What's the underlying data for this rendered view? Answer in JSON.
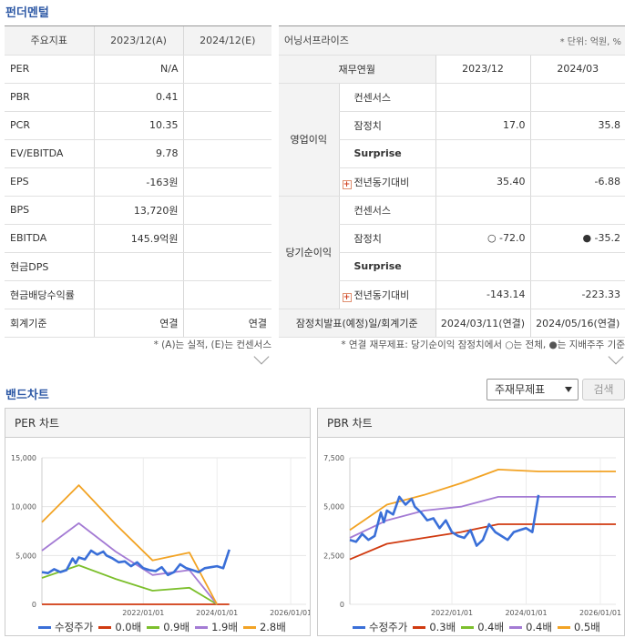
{
  "fundamental": {
    "title": "펀더멘털",
    "headers": [
      "주요지표",
      "2023/12(A)",
      "2024/12(E)"
    ],
    "rows": [
      {
        "label": "PER",
        "a": "N/A",
        "e": ""
      },
      {
        "label": "PBR",
        "a": "0.41",
        "e": ""
      },
      {
        "label": "PCR",
        "a": "10.35",
        "e": ""
      },
      {
        "label": "EV/EBITDA",
        "a": "9.78",
        "e": ""
      },
      {
        "label": "EPS",
        "a": "-163원",
        "e": ""
      },
      {
        "label": "BPS",
        "a": "13,720원",
        "e": ""
      },
      {
        "label": "EBITDA",
        "a": "145.9억원",
        "e": ""
      },
      {
        "label": "현금DPS",
        "a": "",
        "e": ""
      },
      {
        "label": "현금배당수익률",
        "a": "",
        "e": ""
      },
      {
        "label": "회계기준",
        "a": "연결",
        "e": "연결"
      }
    ],
    "note": "* (A)는 실적, (E)는 컨센서스"
  },
  "earnings": {
    "title": "어닝서프라이즈",
    "unit": "* 단위: 억원, %",
    "sub_header": "재무연월",
    "col1": "2023/12",
    "col2": "2024/03",
    "groups": [
      {
        "name": "영업이익",
        "rows": [
          {
            "label": "컨센서스",
            "v1": "",
            "v2": "",
            "plus": false,
            "bold": false
          },
          {
            "label": "잠정치",
            "v1": "17.0",
            "v2": "35.8",
            "plus": false,
            "bold": false
          },
          {
            "label": "Surprise",
            "v1": "",
            "v2": "",
            "plus": false,
            "bold": true
          },
          {
            "label": "전년동기대비",
            "v1": "35.40",
            "v2": "-6.88",
            "plus": true,
            "bold": false
          }
        ]
      },
      {
        "name": "당기순이익",
        "rows": [
          {
            "label": "컨센서스",
            "v1": "",
            "v2": "",
            "plus": false,
            "bold": false
          },
          {
            "label": "잠정치",
            "v1": "○ -72.0",
            "v2": "● -35.2",
            "plus": false,
            "bold": false
          },
          {
            "label": "Surprise",
            "v1": "",
            "v2": "",
            "plus": false,
            "bold": true
          },
          {
            "label": "전년동기대비",
            "v1": "-143.14",
            "v2": "-223.33",
            "plus": true,
            "bold": false
          }
        ]
      }
    ],
    "footer": {
      "label": "잠정치발표(예정)일/회계기준",
      "v1": "2024/03/11(연결)",
      "v2": "2024/05/16(연결)"
    },
    "note": "* 연결 재무제표: 당기순이익 잠정치에서 ○는 전체, ●는 지배주주 기준"
  },
  "band": {
    "title": "밴드차트",
    "select_value": "주재무제표",
    "search_label": "검색"
  },
  "chart_data": [
    {
      "type": "line",
      "title": "PER 차트",
      "x_ticks": [
        "2022/01/01",
        "2024/01/01",
        "2026/01/01"
      ],
      "y_ticks": [
        "15,000",
        "10,000",
        "5,000",
        "0"
      ],
      "ylim": [
        0,
        15000
      ],
      "xlim": [
        "2019/04/01",
        "2026/06/01"
      ],
      "series": [
        {
          "name": "수정주가",
          "color": "#3a6fd8",
          "dates": [
            "2019/04",
            "2019/06",
            "2019/08",
            "2019/10",
            "2019/12",
            "2020/02",
            "2020/03",
            "2020/04",
            "2020/06",
            "2020/08",
            "2020/10",
            "2020/12",
            "2021/01",
            "2021/03",
            "2021/05",
            "2021/07",
            "2021/09",
            "2021/11",
            "2022/01",
            "2022/03",
            "2022/05",
            "2022/07",
            "2022/09",
            "2022/11",
            "2023/01",
            "2023/03",
            "2023/05",
            "2023/07",
            "2023/09",
            "2023/11",
            "2024/01",
            "2024/03",
            "2024/05"
          ],
          "values": [
            3300,
            3200,
            3600,
            3300,
            3500,
            4700,
            4200,
            4800,
            4600,
            5500,
            5100,
            5400,
            5000,
            4700,
            4300,
            4400,
            3900,
            4300,
            3700,
            3500,
            3400,
            3800,
            3000,
            3300,
            4100,
            3700,
            3500,
            3300,
            3700,
            3800,
            3900,
            3700,
            5600
          ]
        },
        {
          "name": "0.0배",
          "color": "#d03a10",
          "dates": [
            "2019/04",
            "2024/05"
          ],
          "values": [
            0,
            0
          ]
        },
        {
          "name": "0.9배",
          "color": "#7cbf2c",
          "dates": [
            "2019/04",
            "2020/04",
            "2021/04",
            "2022/04",
            "2023/04",
            "2024/01"
          ],
          "values": [
            2700,
            4000,
            2600,
            1400,
            1700,
            0
          ]
        },
        {
          "name": "1.9배",
          "color": "#a47bd4",
          "dates": [
            "2019/04",
            "2020/04",
            "2021/04",
            "2022/04",
            "2023/04",
            "2024/01"
          ],
          "values": [
            5500,
            8300,
            5400,
            3000,
            3500,
            0
          ]
        },
        {
          "name": "2.8배",
          "color": "#f2a324",
          "dates": [
            "2019/04",
            "2020/04",
            "2021/04",
            "2022/04",
            "2023/04",
            "2024/01"
          ],
          "values": [
            8400,
            12200,
            8200,
            4500,
            5300,
            0
          ]
        }
      ]
    },
    {
      "type": "line",
      "title": "PBR 차트",
      "x_ticks": [
        "2022/01/01",
        "2024/01/01",
        "2026/01/01"
      ],
      "y_ticks": [
        "7,500",
        "5,000",
        "2,500",
        "0"
      ],
      "ylim": [
        0,
        7500
      ],
      "xlim": [
        "2019/04/01",
        "2026/06/01"
      ],
      "series": [
        {
          "name": "수정주가",
          "color": "#3a6fd8",
          "dates": [
            "2019/04",
            "2019/06",
            "2019/08",
            "2019/10",
            "2019/12",
            "2020/02",
            "2020/03",
            "2020/04",
            "2020/06",
            "2020/08",
            "2020/10",
            "2020/12",
            "2021/01",
            "2021/03",
            "2021/05",
            "2021/07",
            "2021/09",
            "2021/11",
            "2022/01",
            "2022/03",
            "2022/05",
            "2022/07",
            "2022/09",
            "2022/11",
            "2023/01",
            "2023/03",
            "2023/05",
            "2023/07",
            "2023/09",
            "2023/11",
            "2024/01",
            "2024/03",
            "2024/05"
          ],
          "values": [
            3300,
            3200,
            3600,
            3300,
            3500,
            4700,
            4200,
            4800,
            4600,
            5500,
            5100,
            5400,
            5000,
            4700,
            4300,
            4400,
            3900,
            4300,
            3700,
            3500,
            3400,
            3800,
            3000,
            3300,
            4100,
            3700,
            3500,
            3300,
            3700,
            3800,
            3900,
            3700,
            5600
          ]
        },
        {
          "name": "0.3배",
          "color": "#d03a10",
          "dates": [
            "2019/04",
            "2020/04",
            "2021/04",
            "2022/04",
            "2023/04",
            "2024/05",
            "2026/06"
          ],
          "values": [
            2300,
            3100,
            3400,
            3700,
            4100,
            4100,
            4100
          ]
        },
        {
          "name": "0.4배",
          "color": "#7cbf2c",
          "dates": [],
          "values": []
        },
        {
          "name": "0.4배",
          "color": "#a47bd4",
          "dates": [
            "2019/04",
            "2020/04",
            "2021/04",
            "2022/04",
            "2023/04",
            "2024/05",
            "2026/06"
          ],
          "values": [
            3400,
            4300,
            4800,
            5000,
            5500,
            5500,
            5500
          ]
        },
        {
          "name": "0.5배",
          "color": "#f2a324",
          "dates": [
            "2019/04",
            "2020/04",
            "2021/04",
            "2022/04",
            "2023/04",
            "2024/05",
            "2026/06"
          ],
          "values": [
            3800,
            5100,
            5600,
            6200,
            6900,
            6800,
            6800
          ]
        }
      ]
    }
  ]
}
